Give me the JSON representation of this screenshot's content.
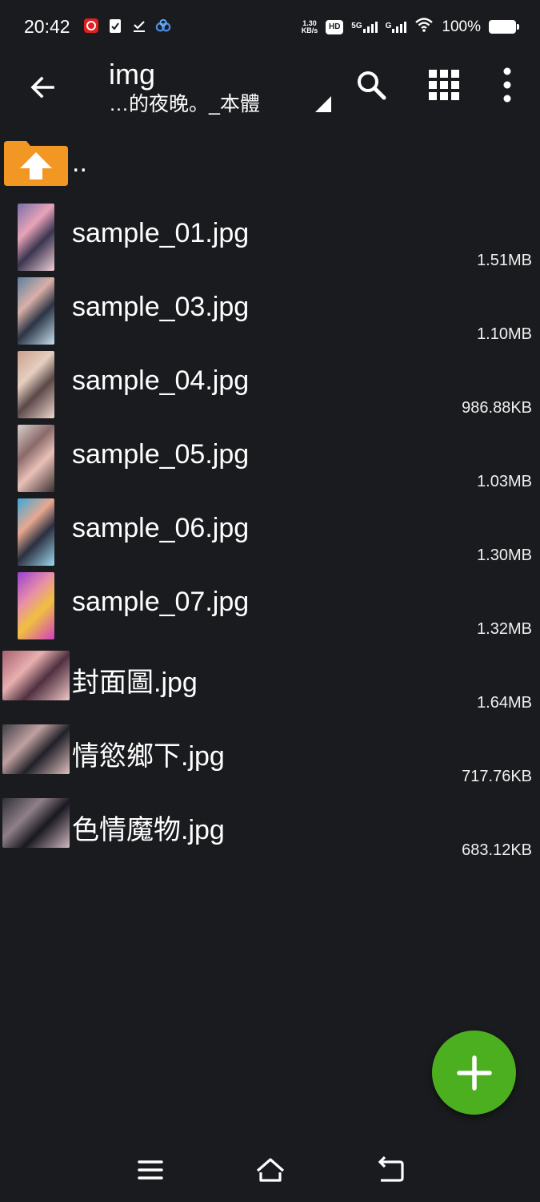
{
  "status": {
    "time": "20:42",
    "net_speed_value": "1.30",
    "net_speed_unit": "KB/s",
    "hd_label": "HD",
    "net1_label": "5G",
    "net2_label": "G",
    "battery": "100%"
  },
  "toolbar": {
    "title": "img",
    "subtitle": "…的夜晚。_本體"
  },
  "parent_label": "..",
  "files": [
    {
      "name": "sample_01.jpg",
      "size": "1.51MB",
      "thumb": [
        "#7a6fa8",
        "#e8a3b8",
        "#3b3550",
        "#f0d0d8"
      ]
    },
    {
      "name": "sample_03.jpg",
      "size": "1.10MB",
      "thumb": [
        "#5a7fa0",
        "#d9b0a8",
        "#2b3444",
        "#c8e0f0"
      ]
    },
    {
      "name": "sample_04.jpg",
      "size": "986.88KB",
      "thumb": [
        "#c9a090",
        "#e6cfc0",
        "#5a4848",
        "#f2d7cf"
      ]
    },
    {
      "name": "sample_05.jpg",
      "size": "1.03MB",
      "thumb": [
        "#d8d0c8",
        "#8a6a6a",
        "#e8c0b8",
        "#3a3030"
      ]
    },
    {
      "name": "sample_06.jpg",
      "size": "1.30MB",
      "thumb": [
        "#3aa8d8",
        "#e8a890",
        "#2a3040",
        "#9fd8f0"
      ]
    },
    {
      "name": "sample_07.jpg",
      "size": "1.32MB",
      "thumb": [
        "#9b40d0",
        "#e890a8",
        "#f0c040",
        "#d040c0"
      ]
    },
    {
      "name": "封面圖.jpg",
      "size": "1.64MB",
      "thumb": [
        "#a86070",
        "#e8b0b0",
        "#503040",
        "#f0c8c8"
      ],
      "wide": true
    },
    {
      "name": "情慾鄉下.jpg",
      "size": "717.76KB",
      "thumb": [
        "#404048",
        "#c0a0a0",
        "#202028",
        "#e0c0c0"
      ],
      "wide": true
    },
    {
      "name": "色情魔物.jpg",
      "size": "683.12KB",
      "thumb": [
        "#303038",
        "#908088",
        "#181820",
        "#d0b8c0"
      ],
      "wide": true
    }
  ],
  "colors": {
    "background": "#1a1b1e",
    "fab": "#4caf1f",
    "folder": "#f29624"
  },
  "icons": {
    "back": "back-arrow-icon",
    "search": "search-icon",
    "grid": "grid-view-icon",
    "more": "more-vert-icon",
    "fab": "plus-icon",
    "nav_menu": "menu-icon",
    "nav_home": "home-icon",
    "nav_back": "back-icon"
  }
}
